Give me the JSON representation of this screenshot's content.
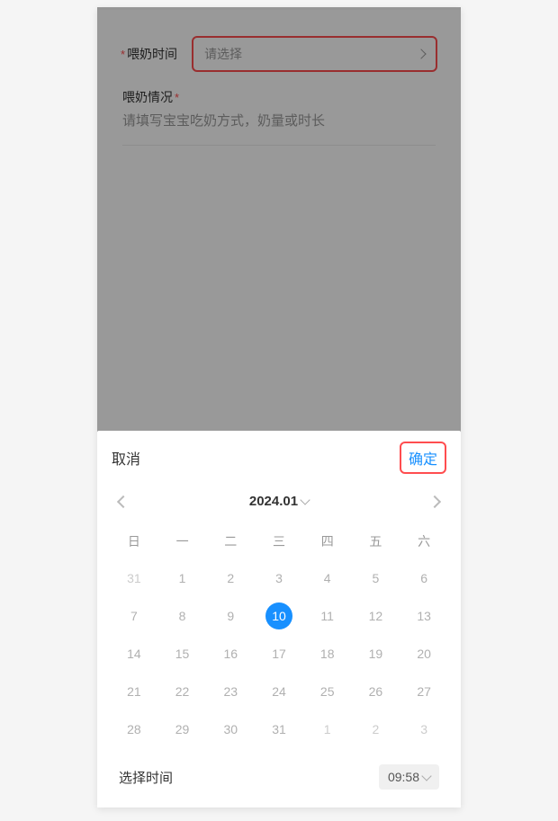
{
  "form": {
    "feedTime": {
      "label": "喂奶时间",
      "placeholder": "请选择"
    },
    "feedSituation": {
      "label": "喂奶情况",
      "placeholder": "请填写宝宝吃奶方式，奶量或时长"
    }
  },
  "picker": {
    "cancel": "取消",
    "confirm": "确定",
    "monthLabel": "2024.01",
    "weekdays": [
      "日",
      "一",
      "二",
      "三",
      "四",
      "五",
      "六"
    ],
    "weeks": [
      [
        {
          "day": "31",
          "type": "other"
        },
        {
          "day": "1",
          "type": "current"
        },
        {
          "day": "2",
          "type": "current"
        },
        {
          "day": "3",
          "type": "current"
        },
        {
          "day": "4",
          "type": "current"
        },
        {
          "day": "5",
          "type": "current"
        },
        {
          "day": "6",
          "type": "current"
        }
      ],
      [
        {
          "day": "7",
          "type": "current"
        },
        {
          "day": "8",
          "type": "current"
        },
        {
          "day": "9",
          "type": "current"
        },
        {
          "day": "10",
          "type": "selected"
        },
        {
          "day": "11",
          "type": "current"
        },
        {
          "day": "12",
          "type": "current"
        },
        {
          "day": "13",
          "type": "current"
        }
      ],
      [
        {
          "day": "14",
          "type": "current"
        },
        {
          "day": "15",
          "type": "current"
        },
        {
          "day": "16",
          "type": "current"
        },
        {
          "day": "17",
          "type": "current"
        },
        {
          "day": "18",
          "type": "current"
        },
        {
          "day": "19",
          "type": "current"
        },
        {
          "day": "20",
          "type": "current"
        }
      ],
      [
        {
          "day": "21",
          "type": "current"
        },
        {
          "day": "22",
          "type": "current"
        },
        {
          "day": "23",
          "type": "current"
        },
        {
          "day": "24",
          "type": "current"
        },
        {
          "day": "25",
          "type": "current"
        },
        {
          "day": "26",
          "type": "current"
        },
        {
          "day": "27",
          "type": "current"
        }
      ],
      [
        {
          "day": "28",
          "type": "current"
        },
        {
          "day": "29",
          "type": "current"
        },
        {
          "day": "30",
          "type": "current"
        },
        {
          "day": "31",
          "type": "current"
        },
        {
          "day": "1",
          "type": "other"
        },
        {
          "day": "2",
          "type": "other"
        },
        {
          "day": "3",
          "type": "other"
        }
      ]
    ],
    "timeLabel": "选择时间",
    "timeValue": "09:58"
  }
}
